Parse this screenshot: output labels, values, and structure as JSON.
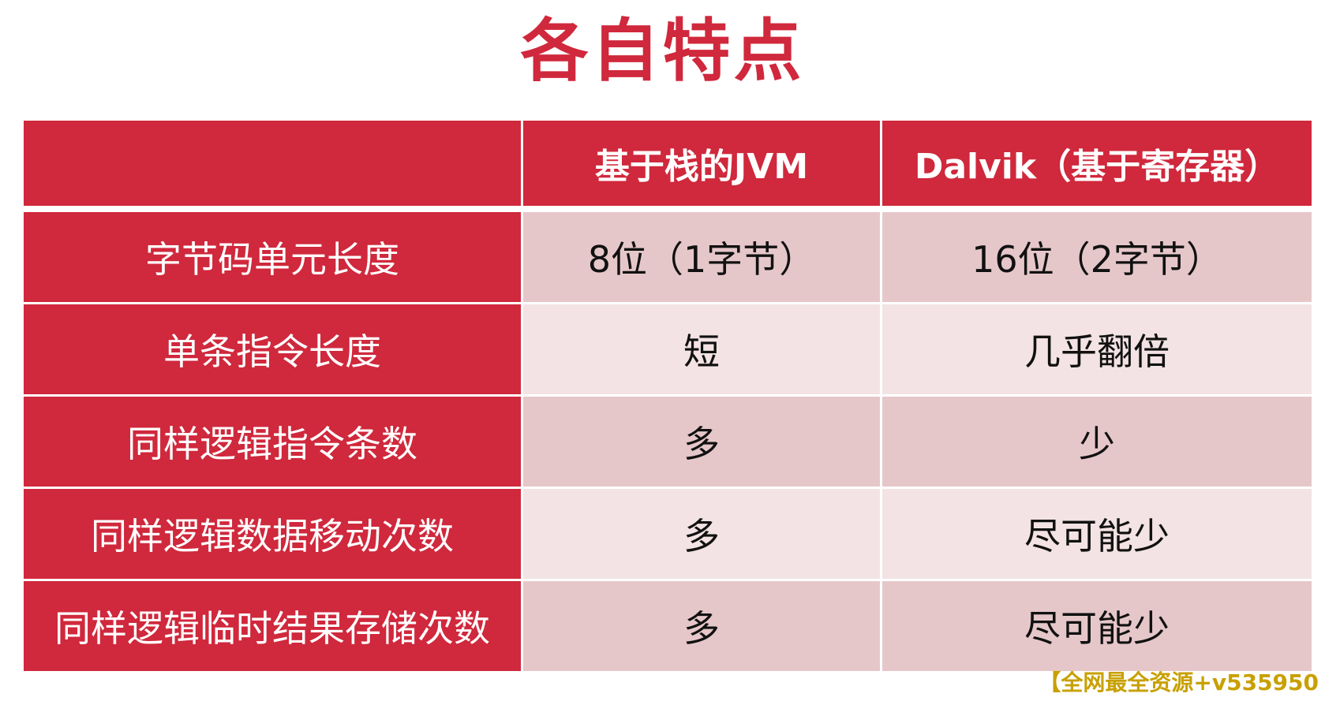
{
  "title": "各自特点",
  "colors": {
    "accent": "#d0283c",
    "row_odd": "#e6c7c9",
    "row_even": "#f3e3e4"
  },
  "table": {
    "headers": [
      "",
      "基于栈的JVM",
      "Dalvik（基于寄存器）"
    ],
    "rows": [
      [
        "字节码单元长度",
        "8位（1字节）",
        "16位（2字节）"
      ],
      [
        "单条指令长度",
        "短",
        "几乎翻倍"
      ],
      [
        "同样逻辑指令条数",
        "多",
        "少"
      ],
      [
        "同样逻辑数据移动次数",
        "多",
        "尽可能少"
      ],
      [
        "同样逻辑临时结果存储次数",
        "多",
        "尽可能少"
      ]
    ]
  },
  "watermark": "【全网最全资源+v535950"
}
